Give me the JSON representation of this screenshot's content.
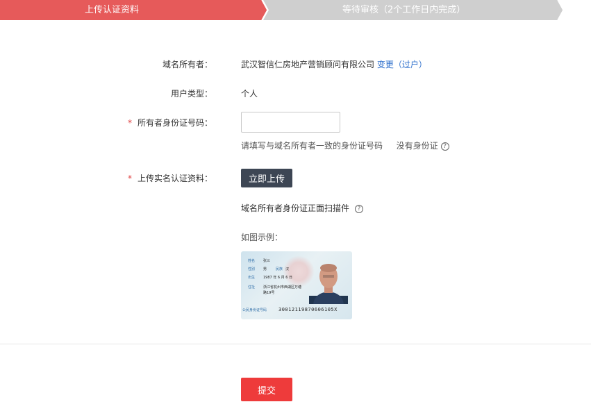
{
  "steps": [
    {
      "label": "上传认证资料",
      "active": true
    },
    {
      "label": "等待审核（2个工作日内完成）",
      "active": false
    }
  ],
  "colors": {
    "active_step": "#e65a5a",
    "inactive_step": "#cfcfcf",
    "link": "#2e6fcc",
    "submit": "#ee3b3b",
    "upload": "#3d4654"
  },
  "form": {
    "owner_label": "域名所有者：",
    "owner_value": "武汉智信仁房地产营销顾问有限公司",
    "owner_change_link": "变更（过户）",
    "user_type_label": "用户类型：",
    "user_type_value": "个人",
    "required_mark": "*",
    "id_number_label": "所有者身份证号码：",
    "id_number_value": "",
    "id_hint": "请填写与域名所有者一致的身份证号码",
    "no_id_link": "没有身份证",
    "upload_label": "上传实名认证资料：",
    "upload_button": "立即上传",
    "upload_hint": "域名所有者身份证正面扫描件",
    "example_label": "如图示例：",
    "submit_button": "提交"
  },
  "id_card_sample": {
    "name_label": "姓名",
    "name": "张三",
    "gender_label": "性别",
    "gender": "男",
    "ethnicity_label": "民族",
    "ethnicity": "汉",
    "birth_label": "出生",
    "birth": "1987 年 6 月 6 日",
    "address_label": "住址",
    "address_line1": "浙江省杭州市西湖区万塘",
    "address_line2": "路19号",
    "id_label": "公民身份证号码",
    "id_number": "30012119870606105X"
  },
  "icons": {
    "help": "question-circle-icon"
  }
}
